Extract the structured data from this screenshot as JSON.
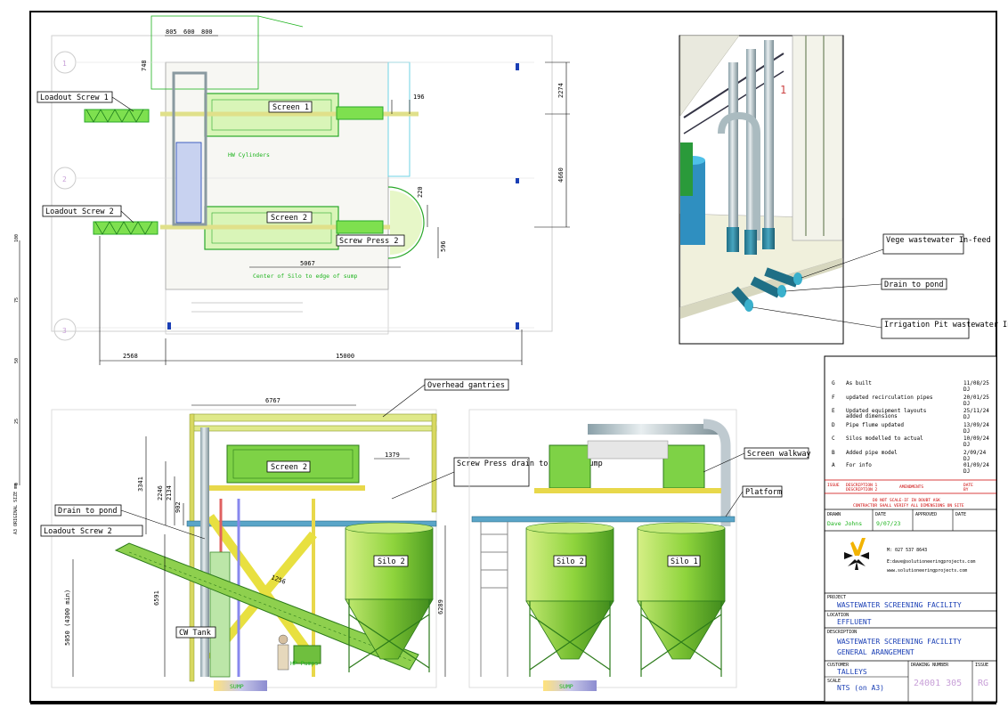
{
  "plan_view": {
    "dims": {
      "d805": "805",
      "d600": "600",
      "d800": "800",
      "d748": "748",
      "d196": "196",
      "d2274": "2274",
      "d4660": "4660",
      "d220": "220",
      "d596": "596",
      "d5067": "5067",
      "d2568": "2568",
      "d15000": "15000"
    },
    "labels": {
      "loadout1": "Loadout Screw 1",
      "loadout2": "Loadout Screw 2",
      "screen1": "Screen 1",
      "screen2": "Screen 2",
      "screw_press2": "Screw Press 2",
      "hw_cylinders": "HW Cylinders",
      "centre_note": "Center of Silo to edge of sump"
    },
    "grid": [
      "1",
      "2",
      "3"
    ]
  },
  "detail_view": {
    "callouts": {
      "vege": "Vege wastewater In-feed",
      "drain": "Drain to pond",
      "irrigation": "Irrigation Pit wastewater In-feed"
    }
  },
  "side_elevation": {
    "callouts": {
      "gantries": "Overhead gantries",
      "screw_press": "Screw Press drain to Screen sump",
      "drain": "Drain to pond",
      "loadout2": "Loadout Screw 2",
      "cw_tank": "CW Tank"
    },
    "labels": {
      "screen2": "Screen 2",
      "silo2": "Silo 2",
      "hp_pumps": "HP Pumps",
      "sump": "SUMP"
    },
    "dims": {
      "d6767": "6767",
      "d3341": "3341",
      "d2246": "2246",
      "d2134": "2134",
      "d902": "902",
      "d1379": "1379",
      "d6591": "6591",
      "d1256": "1256",
      "d6289": "6289",
      "d5050": "5050 (4300 min)"
    }
  },
  "end_elevation": {
    "callouts": {
      "walkway": "Screen walkway",
      "platform": "Platform"
    },
    "labels": {
      "silo2": "Silo 2",
      "silo1": "Silo 1",
      "sump": "SUMP"
    }
  },
  "title_block": {
    "revisions": [
      {
        "issue": "G",
        "desc": "As built",
        "date": "11/08/25",
        "by": "DJ"
      },
      {
        "issue": "F",
        "desc": "updated recirculation pipes",
        "date": "20/01/25",
        "by": "DJ"
      },
      {
        "issue": "E",
        "desc": "Updated equipment layouts",
        "desc2": "added dimensions",
        "date": "25/11/24",
        "by": "DJ"
      },
      {
        "issue": "D",
        "desc": "Pipe flume updated",
        "date": "13/09/24",
        "by": "DJ"
      },
      {
        "issue": "C",
        "desc": "Silos modelled to actual",
        "date": "10/09/24",
        "by": "DJ"
      },
      {
        "issue": "B",
        "desc": "Added pipe model",
        "date": "2/09/24",
        "by": "DJ"
      },
      {
        "issue": "A",
        "desc": "For info",
        "date": "01/09/24",
        "by": "DJ"
      }
    ],
    "rev_header": {
      "issue": "ISSUE",
      "d1": "DESCRIPTION 1",
      "d2": "DESCRIPTION 2",
      "amend": "AMENDMENTS",
      "date": "DATE",
      "by": "BY"
    },
    "warning1": "DO NOT SCALE-IF IN DOUBT ASK",
    "warning2": "CONTRACTOR SHALL VERIFY ALL DIMENSIONS ON SITE",
    "drawn_lbl": "DRAWN",
    "date_lbl": "DATE",
    "approved_lbl": "APPROVED",
    "drawn": "Dave Johns",
    "date": "9/07/23",
    "contact": {
      "mobile": "M: 027 537 8643",
      "email": "E:dave@solutioneeringprojects.com",
      "web": "www.solutioneeringprojects.com"
    },
    "project_lbl": "PROJECT",
    "project": "WASTEWATER SCREENING FACILITY",
    "location_lbl": "LOCATION",
    "location": "EFFLUENT",
    "desc_lbl": "DESCRIPTION",
    "desc1": "WASTEWATER  SCREENING FACILITY",
    "desc2": "GENERAL ARANGEMENT",
    "customer_lbl": "CUSTOMER",
    "customer": "TALLEYS",
    "dwg_lbl": "DRAWING NUMBER",
    "dwg": "24001 305",
    "issue_lbl": "ISSUE",
    "issue": "RG",
    "scale_lbl": "SCALE",
    "scale": "NTS (on A3)"
  },
  "margin": {
    "ruler": [
      "100",
      "75",
      "50",
      "25",
      "0"
    ],
    "note": "A3 ORIGINAL SIZE mm"
  }
}
